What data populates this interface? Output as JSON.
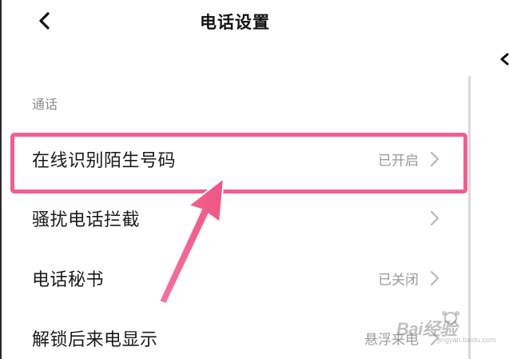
{
  "header": {
    "title": "电话设置",
    "back_icon": "chevron-left-icon"
  },
  "section": {
    "label": "通话"
  },
  "rows": [
    {
      "label": "在线识别陌生号码",
      "status": "已开启"
    },
    {
      "label": "骚扰电话拦截",
      "status": ""
    },
    {
      "label": "电话秘书",
      "status": "已关闭"
    },
    {
      "label": "解锁后来电显示",
      "status": "悬浮来电"
    }
  ],
  "watermark": {
    "brand": "Bai经验",
    "sub": "经验",
    "url": "jingyan.baidu.com"
  },
  "colors": {
    "highlight": "#f0608c",
    "text_primary": "#1a1a1a",
    "text_secondary": "#9a9a9a",
    "section_label": "#8a8a8a",
    "chevron": "#b5b5b5"
  }
}
